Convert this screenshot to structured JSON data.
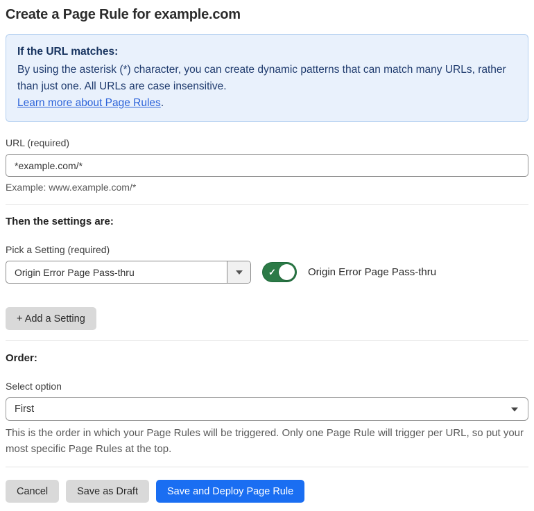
{
  "page": {
    "title": "Create a Page Rule for example.com"
  },
  "info_box": {
    "heading": "If the URL matches:",
    "body": "By using the asterisk (*) character, you can create dynamic patterns that can match many URLs, rather than just one. All URLs are case insensitive.",
    "link_label": "Learn more about Page Rules",
    "link_suffix": "."
  },
  "url_field": {
    "label": "URL (required)",
    "value": "*example.com/*",
    "helper": "Example: www.example.com/*"
  },
  "settings_section": {
    "heading": "Then the settings are:",
    "pick_label": "Pick a Setting (required)",
    "selected_setting": "Origin Error Page Pass-thru",
    "toggle_state": "on",
    "toggle_check_glyph": "✓",
    "toggle_label": "Origin Error Page Pass-thru",
    "add_button_label": "+ Add a Setting"
  },
  "order_section": {
    "heading": "Order:",
    "label": "Select option",
    "selected_option": "First",
    "helper": "This is the order in which your Page Rules will be triggered. Only one Page Rule will trigger per URL, so put your most specific Page Rules at the top."
  },
  "footer": {
    "cancel_label": "Cancel",
    "save_draft_label": "Save as Draft",
    "save_deploy_label": "Save and Deploy Page Rule"
  },
  "colors": {
    "info_background": "#e9f1fc",
    "info_border": "#b3cff0",
    "info_text": "#1e3a6d",
    "link_blue": "#2b62d9",
    "toggle_green": "#2c7a47",
    "primary_button_blue": "#1a6ef2",
    "secondary_button_gray": "#d9d9d9"
  }
}
